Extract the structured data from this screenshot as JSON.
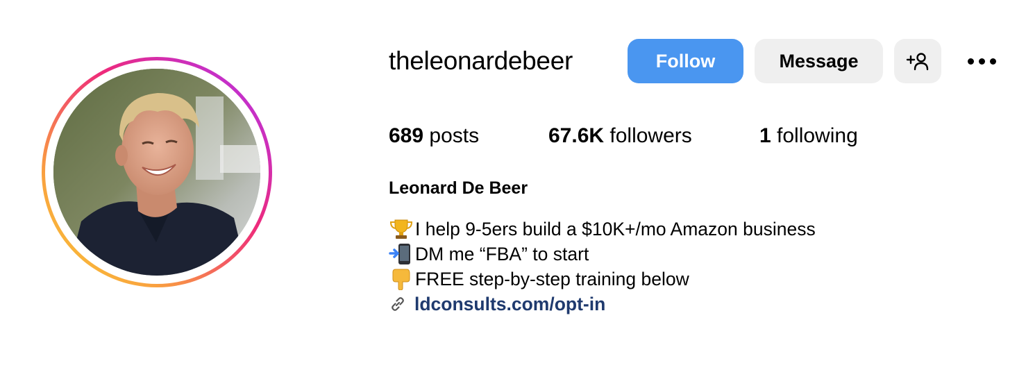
{
  "profile": {
    "username": "theleonardebeer",
    "full_name": "Leonard De Beer"
  },
  "actions": {
    "follow_label": "Follow",
    "message_label": "Message",
    "suggest_icon": "add-person-icon",
    "options_icon": "more-options-icon"
  },
  "stats": {
    "posts": {
      "count": "689",
      "label": " posts"
    },
    "followers": {
      "count": "67.6K",
      "label": " followers"
    },
    "following": {
      "count": "1",
      "label": " following"
    }
  },
  "bio": {
    "lines": [
      {
        "icon": "trophy-icon",
        "text": " I help 9-5ers build a $10K+/mo Amazon business"
      },
      {
        "icon": "mobile-phone-arrow-icon",
        "text": "DM me “FBA” to start"
      },
      {
        "icon": "pointing-down-hand-icon",
        "text": "FREE step-by-step training below"
      }
    ],
    "link": {
      "icon": "link-icon",
      "text": "ldconsults.com/opt-in"
    }
  },
  "colors": {
    "follow_button": "#4a96f0",
    "secondary_button": "#efefef",
    "link_text": "#1f3a6e",
    "story_ring": [
      "#f9ce34",
      "#ee2a7b",
      "#a83fe0"
    ]
  }
}
